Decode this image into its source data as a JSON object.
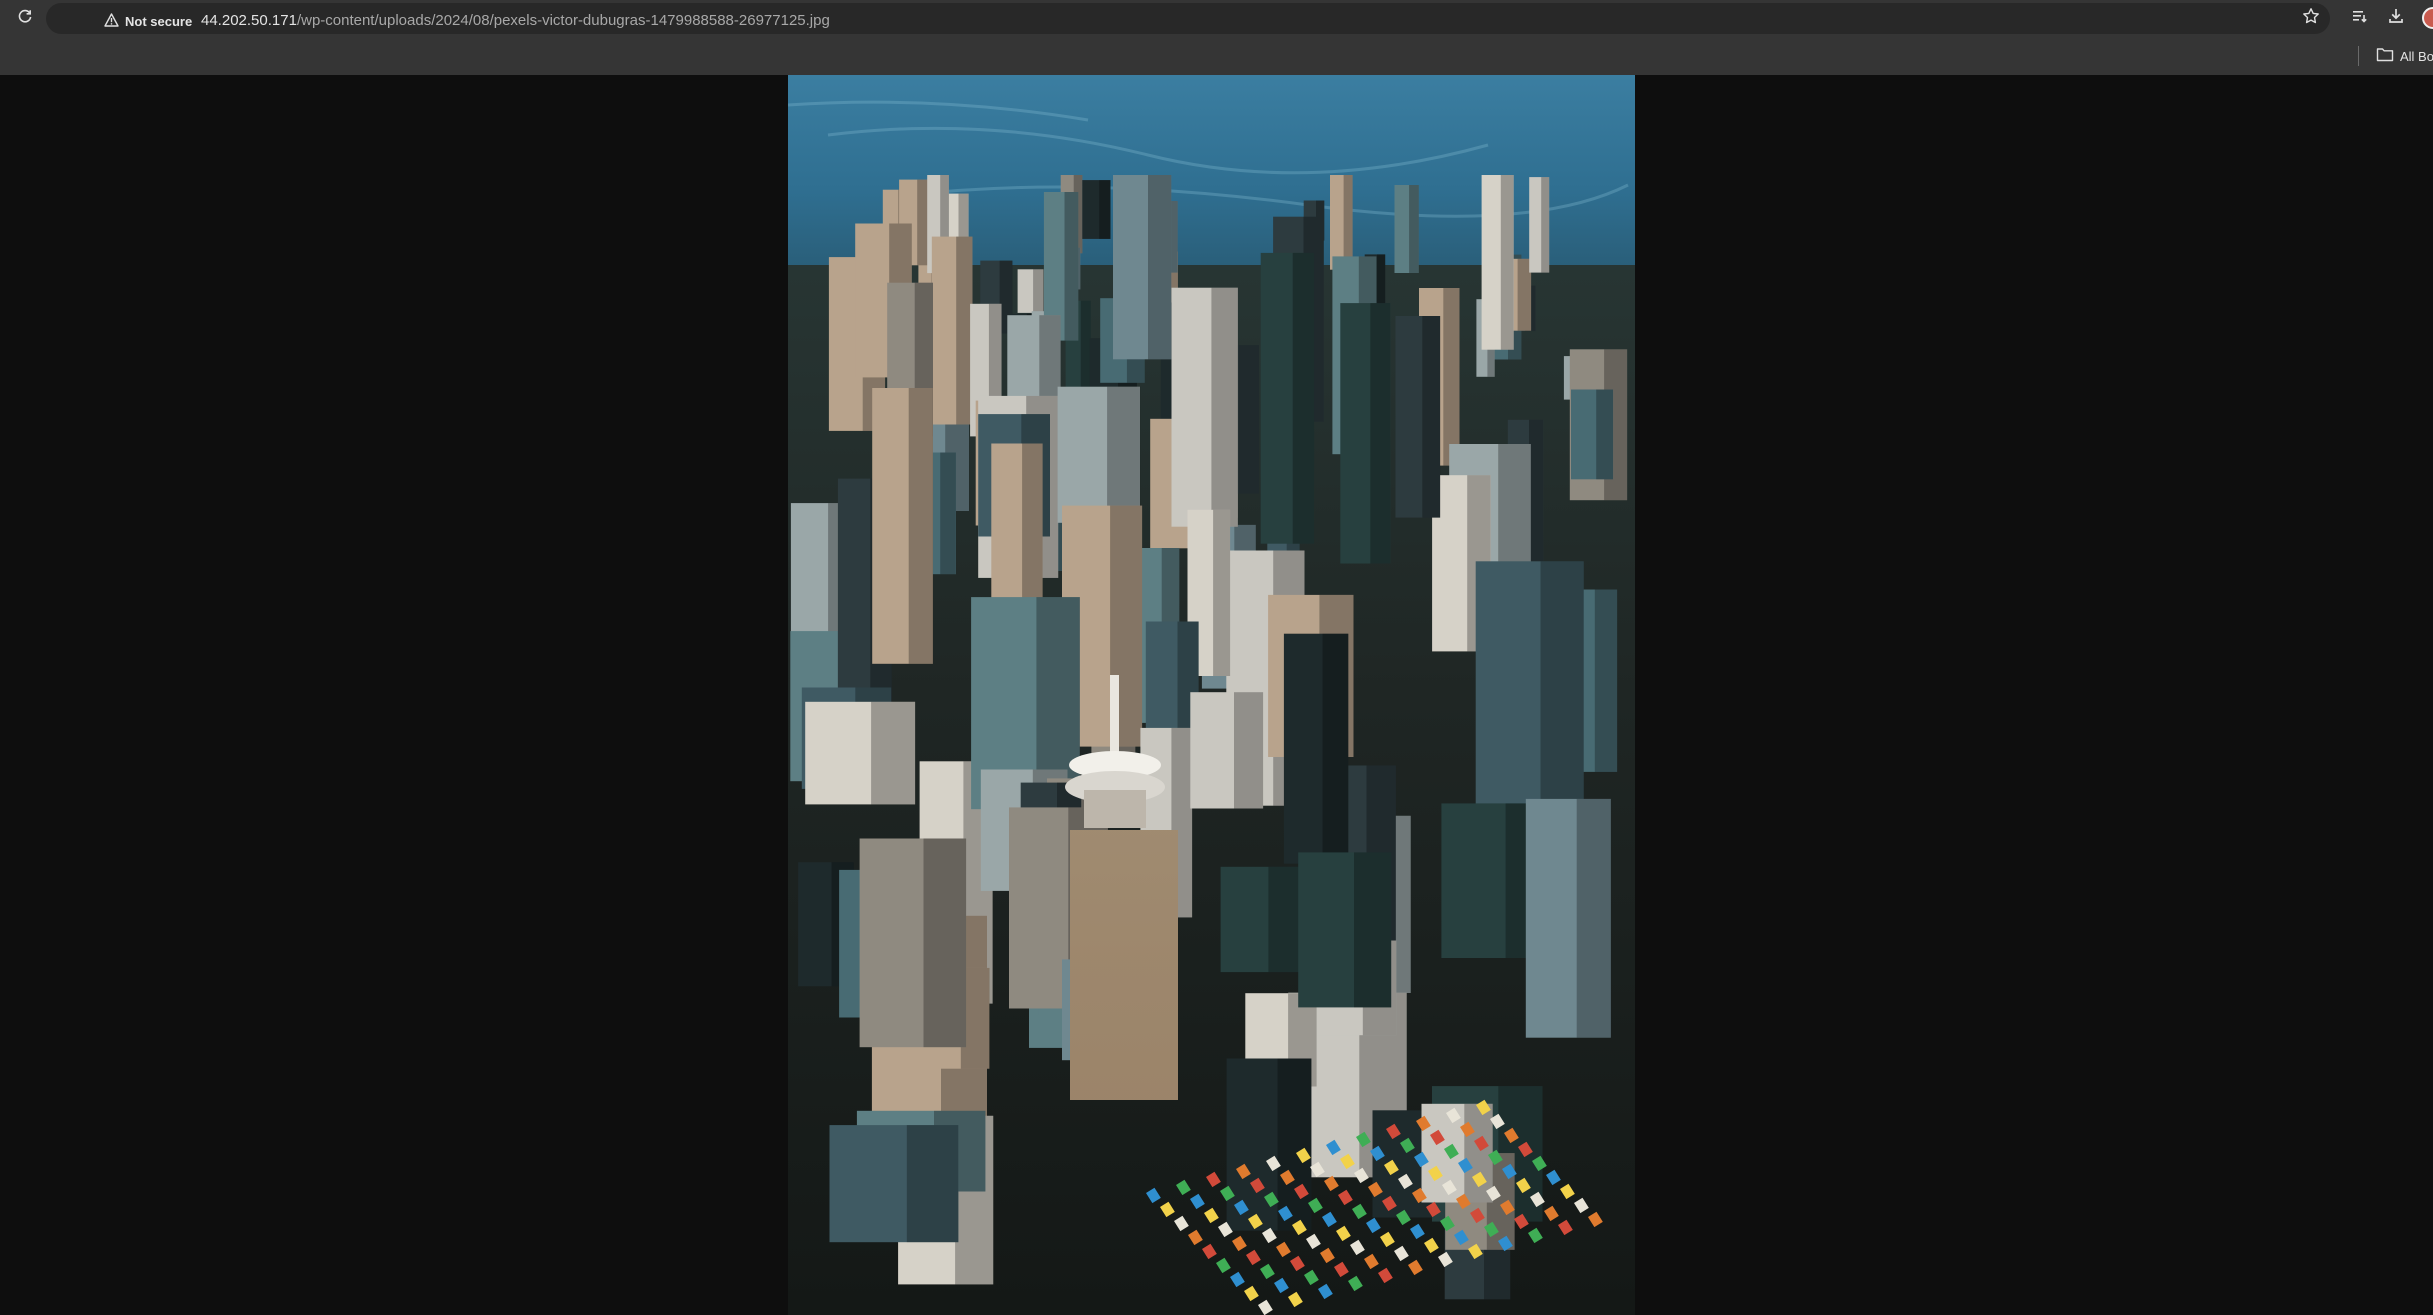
{
  "browser": {
    "security_label": "Not secure",
    "url_host": "44.202.50.171",
    "url_path": "/wp-content/uploads/2024/08/pexels-victor-dubugras-1479988588-26977125.jpg",
    "bookmarks_all_label": "All Bo"
  },
  "icons": {
    "reload": "reload-icon",
    "warning": "warning-icon",
    "star": "star-icon",
    "tab_search": "tab-search-icon",
    "download": "download-icon",
    "folder": "folder-icon"
  },
  "image": {
    "subject": "aerial city skyline photo"
  }
}
